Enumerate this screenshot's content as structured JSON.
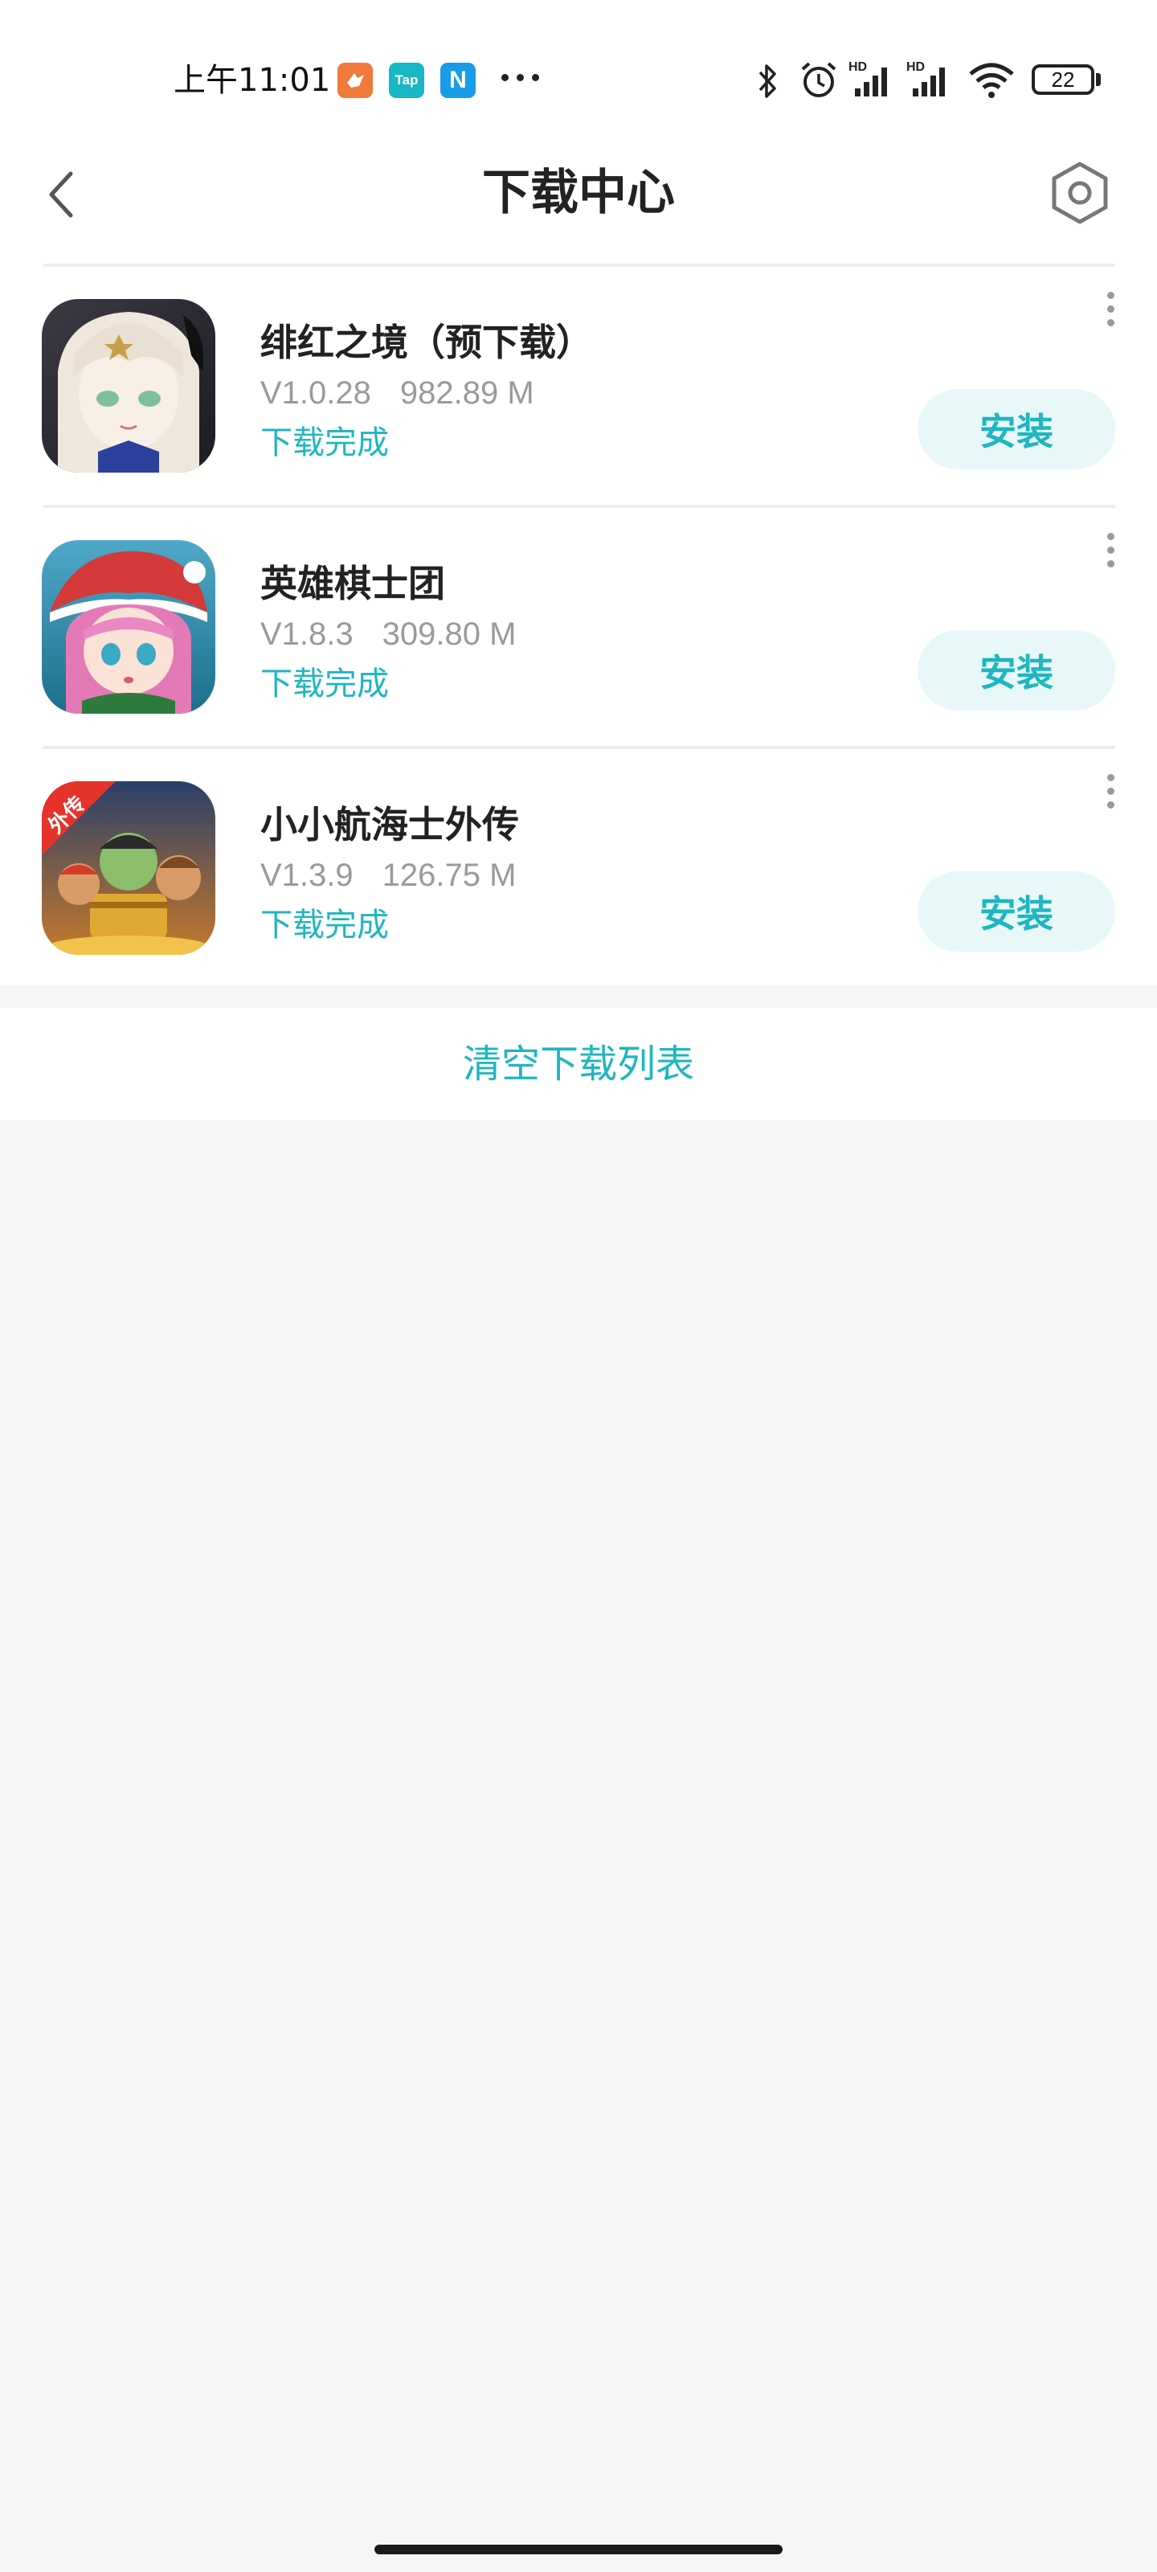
{
  "status_bar": {
    "time": "上午11:01",
    "notification_icons": [
      "bird-app-icon",
      "taptap-icon",
      "n-app-icon"
    ],
    "taptap_text": "Tap",
    "n_text": "N",
    "battery": "22",
    "signal_labels": [
      "HD",
      "HD"
    ]
  },
  "header": {
    "title": "下载中心",
    "back_icon": "chevron-left-icon",
    "settings_icon": "settings-hexagon-icon"
  },
  "downloads": [
    {
      "name": "绯红之境（预下载）",
      "version": "V1.0.28",
      "size": "982.89 M",
      "status": "下载完成",
      "action": "安装"
    },
    {
      "name": "英雄棋士团",
      "version": "V1.8.3",
      "size": "309.80 M",
      "status": "下载完成",
      "action": "安装"
    },
    {
      "name": "小小航海士外传",
      "version": "V1.3.9",
      "size": "126.75 M",
      "status": "下载完成",
      "action": "安装",
      "icon_badge": "外传"
    }
  ],
  "clear_label": "清空下载列表",
  "colors": {
    "accent": "#1eb6c0",
    "accent_bg": "#e8f8f9",
    "page_bg": "#f4f5f7"
  }
}
